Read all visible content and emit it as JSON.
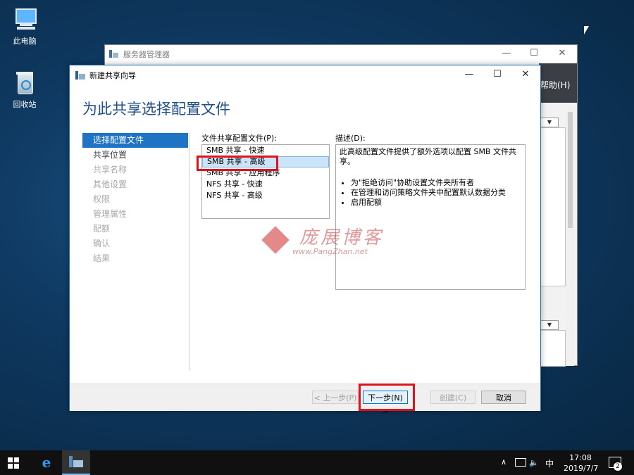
{
  "desktop": {
    "icons": [
      {
        "label": "此电脑"
      },
      {
        "label": "回收站"
      }
    ]
  },
  "server_manager": {
    "title": "服务器管理器",
    "menu_help": "帮助(H)",
    "controls": {
      "minimize": "—",
      "maximize": "☐",
      "close": "✕"
    }
  },
  "wizard": {
    "title": "新建共享向导",
    "heading": "为此共享选择配置文件",
    "controls": {
      "minimize": "—",
      "maximize": "☐",
      "close": "✕"
    },
    "nav": [
      {
        "label": "选择配置文件",
        "state": "active"
      },
      {
        "label": "共享位置",
        "state": "enabled"
      },
      {
        "label": "共享名称",
        "state": "disabled"
      },
      {
        "label": "其他设置",
        "state": "disabled"
      },
      {
        "label": "权限",
        "state": "disabled"
      },
      {
        "label": "管理属性",
        "state": "disabled"
      },
      {
        "label": "配额",
        "state": "disabled"
      },
      {
        "label": "确认",
        "state": "disabled"
      },
      {
        "label": "结果",
        "state": "disabled"
      }
    ],
    "profiles_label": "文件共享配置文件(P):",
    "profiles": [
      {
        "label": "SMB 共享 - 快速"
      },
      {
        "label": "SMB 共享 - 高级",
        "selected": true
      },
      {
        "label": "SMB 共享 - 应用程序"
      },
      {
        "label": "NFS 共享 - 快速"
      },
      {
        "label": "NFS 共享 - 高级"
      }
    ],
    "description_label": "描述(D):",
    "description_text": "此高级配置文件提供了额外选项以配置 SMB 文件共享。",
    "description_bullets": [
      "为\"拒绝访问\"协助设置文件夹所有者",
      "在管理和访问策略文件夹中配置默认数据分类",
      "启用配额"
    ],
    "buttons": {
      "prev": "< 上一步(P)",
      "next": "下一步(N) >",
      "create": "创建(C)",
      "cancel": "取消"
    }
  },
  "watermark": {
    "title": "庞展博客",
    "url": "www.PangZhan.net"
  },
  "taskbar": {
    "ime": "中",
    "time": "17:08",
    "date": "2019/7/7",
    "notification_count": "2",
    "tray_chevron": "∧"
  }
}
